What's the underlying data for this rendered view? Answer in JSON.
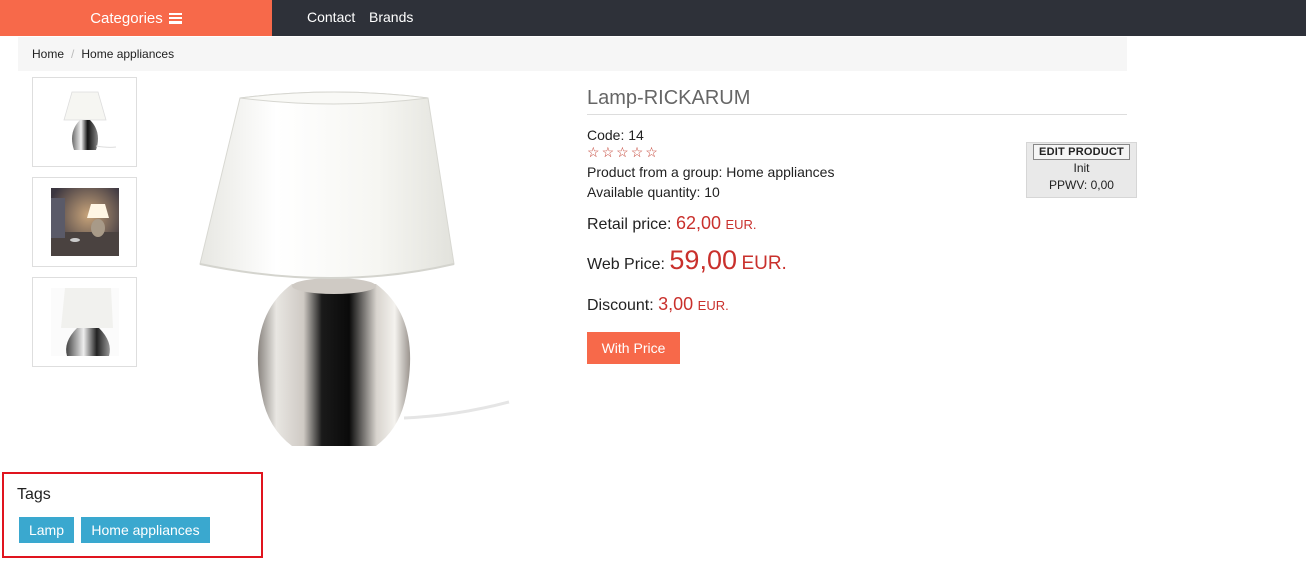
{
  "nav": {
    "categories_label": "Categories",
    "links": [
      "Contact",
      "Brands"
    ]
  },
  "breadcrumb": [
    "Home",
    "Home appliances"
  ],
  "product": {
    "title": "Lamp-RICKARUM",
    "code_label": "Code:",
    "code": "14",
    "rating": 0,
    "rating_max": 5,
    "group_label": "Product from a group:",
    "group": "Home appliances",
    "quantity_label": "Available quantity:",
    "quantity": "10",
    "retail_label": "Retail price:",
    "retail_price": "62,00",
    "web_label": "Web Price:",
    "web_price": "59,00",
    "discount_label": "Discount:",
    "discount": "3,00",
    "currency": "EUR.",
    "button_label": "With Price"
  },
  "edit_box": {
    "button_label": "EDIT PRODUCT",
    "line1": "Init",
    "line2": "PPWV: 0,00"
  },
  "tags": {
    "title": "Tags",
    "items": [
      "Lamp",
      "Home appliances"
    ]
  },
  "colors": {
    "accent": "#f7694a",
    "nav_bg": "#2e3139",
    "price_red": "#c9302c",
    "tag_blue": "#3aa8cf",
    "highlight_red": "#e0141e"
  }
}
